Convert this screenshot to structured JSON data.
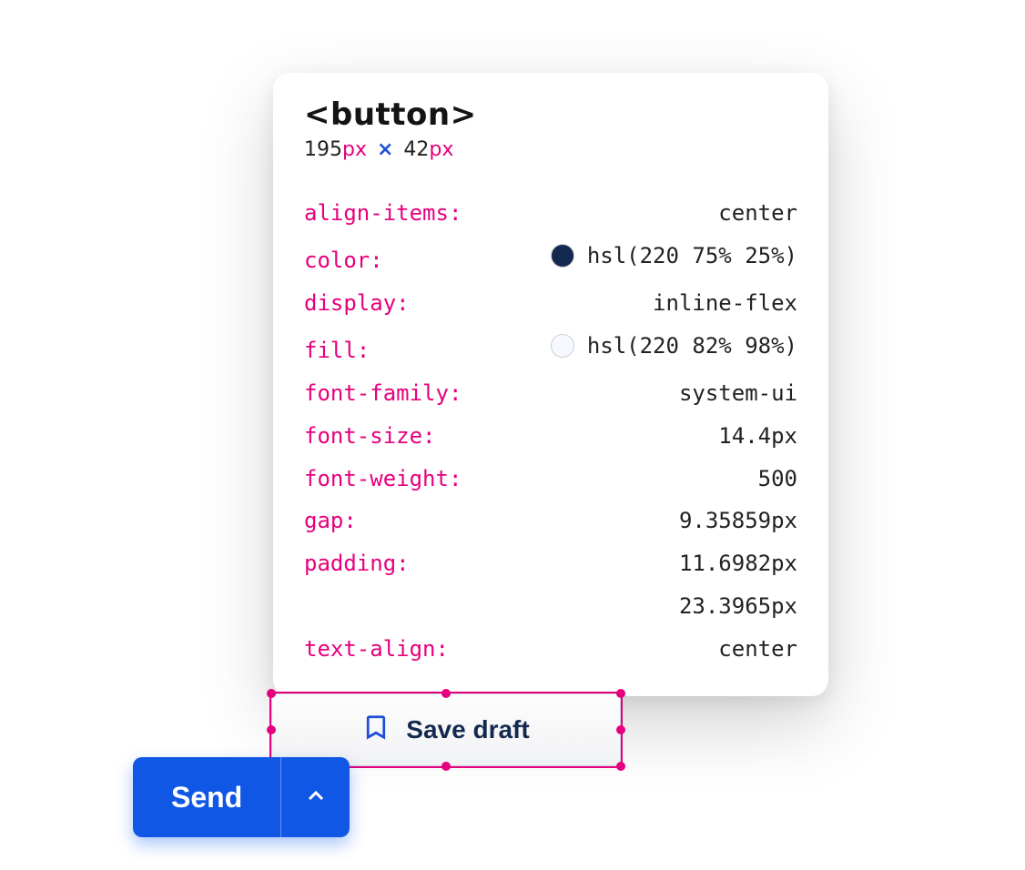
{
  "inspector": {
    "element": "<button>",
    "width_value": "195",
    "height_value": "42",
    "px_suffix_w": "px",
    "px_suffix_h": "px",
    "sep": "×",
    "props": {
      "align_items": {
        "name": "align-items:",
        "value": "center"
      },
      "color": {
        "name": "color:",
        "value": "hsl(220 75% 25%)",
        "swatch": "#13294f"
      },
      "display": {
        "name": "display:",
        "value": "inline-flex"
      },
      "fill": {
        "name": "fill:",
        "value": "hsl(220 82% 98%)",
        "swatch": "#f6f9ff"
      },
      "font_family": {
        "name": "font-family:",
        "value": "system-ui"
      },
      "font_size": {
        "name": "font-size:",
        "value": "14.4px"
      },
      "font_weight": {
        "name": "font-weight:",
        "value": "500"
      },
      "gap": {
        "name": "gap:",
        "value": "9.35859px"
      },
      "padding": {
        "name": "padding:",
        "value1": "11.6982px",
        "value2": "23.3965px"
      },
      "text_align": {
        "name": "text-align:",
        "value": "center"
      }
    }
  },
  "buttons": {
    "save_draft": "Save draft",
    "send": "Send"
  }
}
